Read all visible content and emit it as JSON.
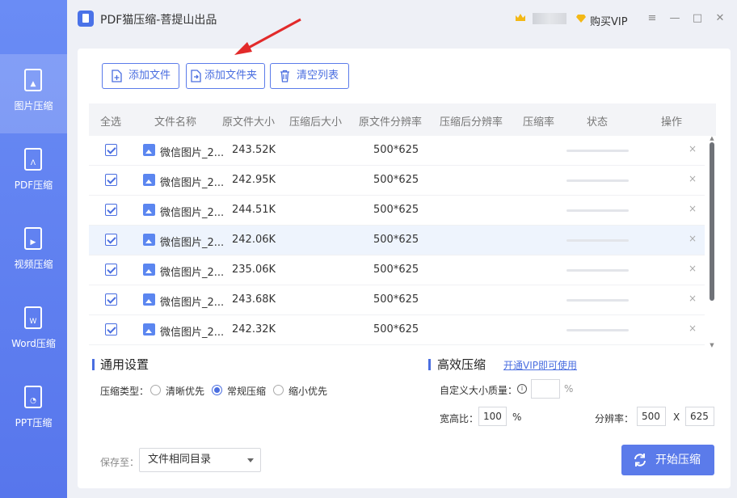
{
  "app": {
    "title": "PDF猫压缩-菩提山出品",
    "buy_vip": "购买VIP"
  },
  "window_controls": {
    "menu": "≡",
    "minimize": "—",
    "maximize": "□",
    "close": "✕"
  },
  "sidebar": {
    "items": [
      {
        "label": "图片压缩",
        "glyph": "▲",
        "active": true
      },
      {
        "label": "PDF压缩",
        "glyph": "ᐱ"
      },
      {
        "label": "视频压缩",
        "glyph": "▶"
      },
      {
        "label": "Word压缩",
        "glyph": "W"
      },
      {
        "label": "PPT压缩",
        "glyph": "◔"
      }
    ]
  },
  "toolbar": {
    "add_file": "添加文件",
    "add_folder": "添加文件夹",
    "clear_list": "清空列表"
  },
  "table": {
    "headers": [
      "全选",
      "文件名称",
      "原文件大小",
      "压缩后大小",
      "原文件分辨率",
      "压缩后分辨率",
      "压缩率",
      "状态",
      "操作"
    ],
    "delete_glyph": "×",
    "rows": [
      {
        "name": "微信图片_2...",
        "size": "243.52K",
        "resolution": "500*625"
      },
      {
        "name": "微信图片_2...",
        "size": "242.95K",
        "resolution": "500*625"
      },
      {
        "name": "微信图片_2...",
        "size": "244.51K",
        "resolution": "500*625"
      },
      {
        "name": "微信图片_2...",
        "size": "242.06K",
        "resolution": "500*625"
      },
      {
        "name": "微信图片_2...",
        "size": "235.06K",
        "resolution": "500*625"
      },
      {
        "name": "微信图片_2...",
        "size": "243.68K",
        "resolution": "500*625"
      },
      {
        "name": "微信图片_2...",
        "size": "242.32K",
        "resolution": "500*625"
      }
    ]
  },
  "general": {
    "title": "通用设置",
    "type_label": "压缩类型：",
    "options": [
      "清晰优先",
      "常规压缩",
      "缩小优先"
    ],
    "selected": "常规压缩"
  },
  "advanced": {
    "title": "高效压缩",
    "vip_link": "开通VIP即可使用",
    "custom_quality_label": "自定义大小质量：",
    "quality_value": "",
    "percent": "%",
    "ratio_label": "宽高比：",
    "ratio_value": "100",
    "resolution_label": "分辨率：",
    "width": "500",
    "x": "X",
    "height": "625"
  },
  "footer": {
    "save_label": "保存至：",
    "save_option": "文件相同目录",
    "start": "开始压缩"
  },
  "colors": {
    "accent": "#5b7bea",
    "sidebar": "#6a8cf5"
  }
}
